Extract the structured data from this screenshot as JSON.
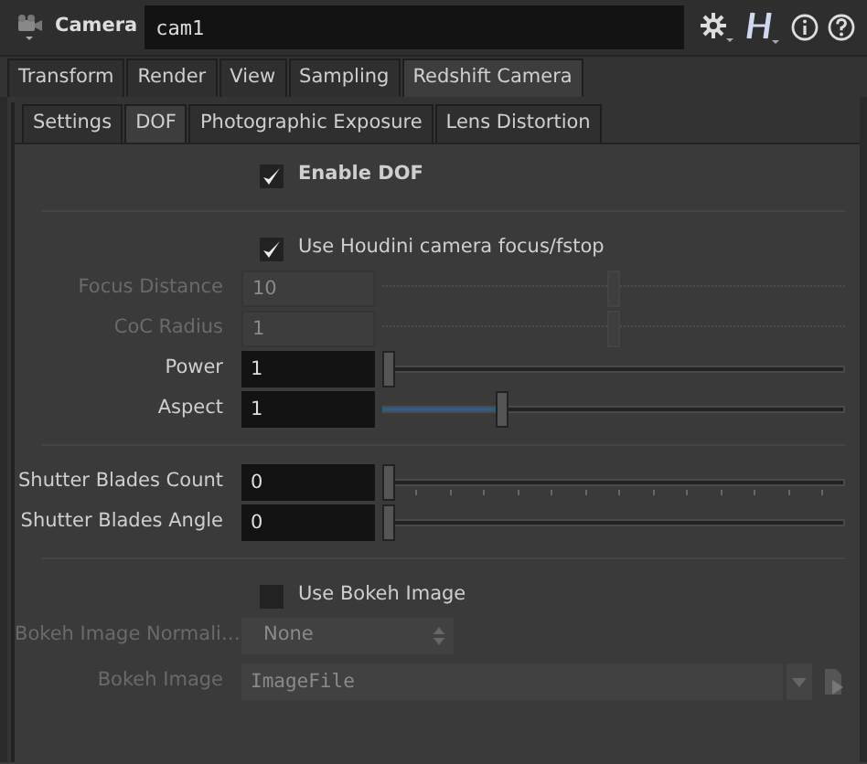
{
  "header": {
    "node_type": "Camera",
    "node_name": "cam1"
  },
  "tabs": [
    {
      "label": "Transform",
      "selected": false
    },
    {
      "label": "Render",
      "selected": false
    },
    {
      "label": "View",
      "selected": false
    },
    {
      "label": "Sampling",
      "selected": false
    },
    {
      "label": "Redshift Camera",
      "selected": true
    }
  ],
  "subtabs": [
    {
      "label": "Settings",
      "selected": false
    },
    {
      "label": "DOF",
      "selected": true
    },
    {
      "label": "Photographic Exposure",
      "selected": false
    },
    {
      "label": "Lens Distortion",
      "selected": false
    }
  ],
  "rows": [
    {
      "kind": "checkbox",
      "label": "Enable DOF",
      "checked": true,
      "bold": true,
      "disabled": false
    },
    {
      "kind": "separator"
    },
    {
      "kind": "checkbox",
      "label": "Use Houdini camera focus/fstop",
      "checked": true,
      "bold": false,
      "disabled": false
    },
    {
      "kind": "slider",
      "label": "Focus Distance",
      "value": "10",
      "level": 0.5,
      "disabled": true
    },
    {
      "kind": "slider",
      "label": "CoC Radius",
      "value": "1",
      "level": 0.5,
      "disabled": true
    },
    {
      "kind": "slider",
      "label": "Power",
      "value": "1",
      "level": 0,
      "disabled": false
    },
    {
      "kind": "slider",
      "label": "Aspect",
      "value": "1",
      "level": 0.25,
      "disabled": false
    },
    {
      "kind": "separator"
    },
    {
      "kind": "slider",
      "label": "Shutter Blades Count",
      "value": "0",
      "level": 0,
      "disabled": false,
      "ticks": true
    },
    {
      "kind": "slider",
      "label": "Shutter Blades Angle",
      "value": "0",
      "level": 0,
      "disabled": false
    },
    {
      "kind": "separator"
    },
    {
      "kind": "checkbox",
      "label": "Use Bokeh Image",
      "checked": false,
      "bold": false,
      "disabled": false
    },
    {
      "kind": "dropdown",
      "label": "Bokeh Image Normali…",
      "value": "None",
      "disabled": true
    },
    {
      "kind": "file",
      "label": "Bokeh Image",
      "value": "ImageFile",
      "disabled": true
    }
  ]
}
